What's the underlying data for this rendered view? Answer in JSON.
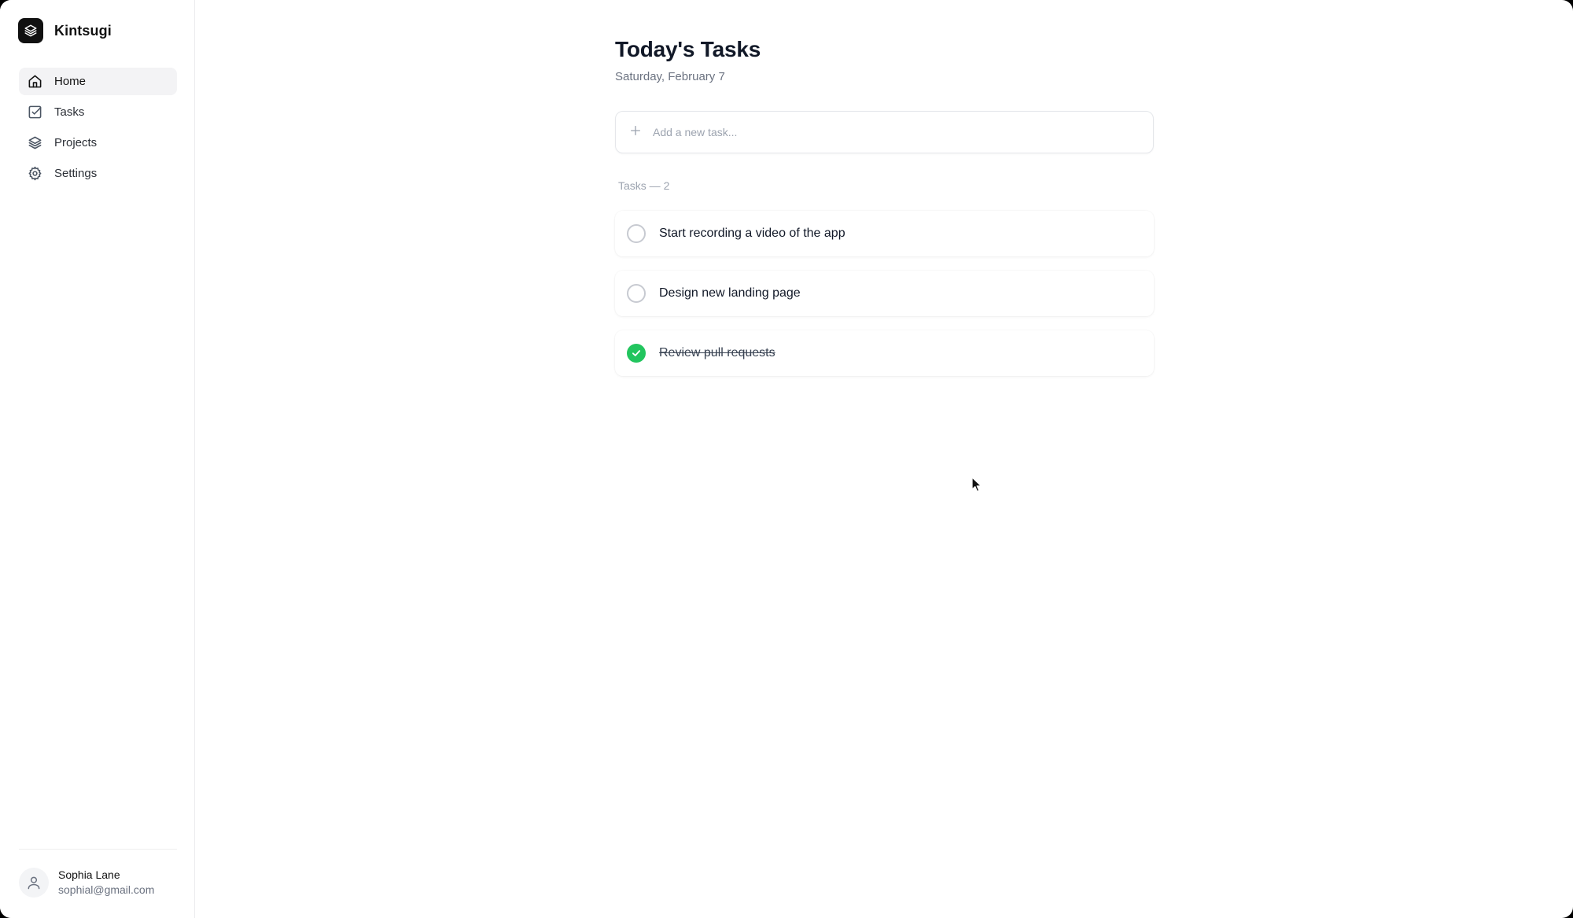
{
  "app": {
    "name": "Kintsugi"
  },
  "sidebar": {
    "items": [
      {
        "label": "Home",
        "icon": "home-icon",
        "active": true
      },
      {
        "label": "Tasks",
        "icon": "checkbox-icon",
        "active": false
      },
      {
        "label": "Projects",
        "icon": "layers-icon",
        "active": false
      },
      {
        "label": "Settings",
        "icon": "gear-icon",
        "active": false
      }
    ],
    "user": {
      "name": "Sophia Lane",
      "email": "sophial@gmail.com"
    }
  },
  "main": {
    "title": "Today's Tasks",
    "date": "Saturday, February 7",
    "add_task": {
      "placeholder": "Add a new task...",
      "value": ""
    },
    "section_label": "Tasks — 2",
    "tasks": [
      {
        "text": "Start recording a video of the app",
        "done": false
      },
      {
        "text": "Design new landing page",
        "done": false
      },
      {
        "text": "Review pull requests",
        "done": true
      }
    ]
  },
  "colors": {
    "accent_done": "#22c55e",
    "brand_logo_bg": "#111111",
    "active_nav_bg": "#f3f3f5"
  }
}
